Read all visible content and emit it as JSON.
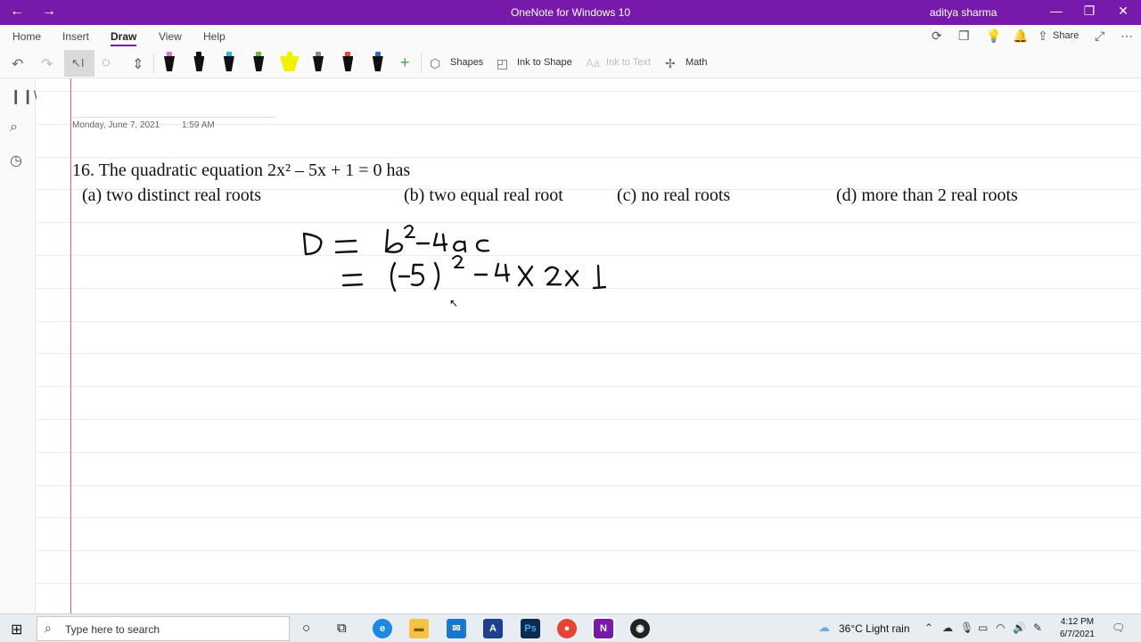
{
  "titlebar": {
    "back": "←",
    "forward": "→",
    "app_title": "OneNote for Windows 10",
    "user": "aditya sharma",
    "minimize": "—",
    "restore": "❐",
    "close": "✕"
  },
  "menu": {
    "tabs": [
      "Home",
      "Insert",
      "Draw",
      "View",
      "Help"
    ],
    "active_tab": "Draw",
    "share_label": "Share"
  },
  "ribbon": {
    "shapes_label": "Shapes",
    "ink_to_shape_label": "Ink to Shape",
    "ink_to_text_label": "Ink to Text",
    "math_label": "Math",
    "pens": [
      {
        "name": "pen-pink",
        "tip": "#e070c8"
      },
      {
        "name": "pen-black",
        "tip": "#111111"
      },
      {
        "name": "pen-cyan",
        "tip": "#21b7e6"
      },
      {
        "name": "pen-green",
        "tip": "#5ac12e"
      },
      {
        "name": "highlighter-yellow",
        "tip": "#f3f000"
      },
      {
        "name": "pen-galaxy",
        "tip": "#8a8a8a"
      },
      {
        "name": "pen-rainbow",
        "tip": "#e84a2b"
      },
      {
        "name": "pen-blue",
        "tip": "#2c68d6"
      }
    ]
  },
  "note": {
    "date": "Monday, June 7, 2021",
    "time": "1:59 AM",
    "question": "16.  The quadratic equation 2x² – 5x + 1 = 0 has",
    "options": {
      "a": "(a)   two distinct real roots",
      "b": "(b) two equal real root",
      "c": "(c) no real roots",
      "d": "(d) more than 2 real roots"
    },
    "ink_line1": "D = b²−4ac",
    "ink_line2": "= (−5)² −4×2×1"
  },
  "taskbar": {
    "search_placeholder": "Type here to search",
    "weather": "36°C  Light rain",
    "clock_time": "4:12 PM",
    "clock_date": "6/7/2021"
  },
  "colors": {
    "accent": "#7719aa",
    "margin_line": "#e2636b"
  }
}
